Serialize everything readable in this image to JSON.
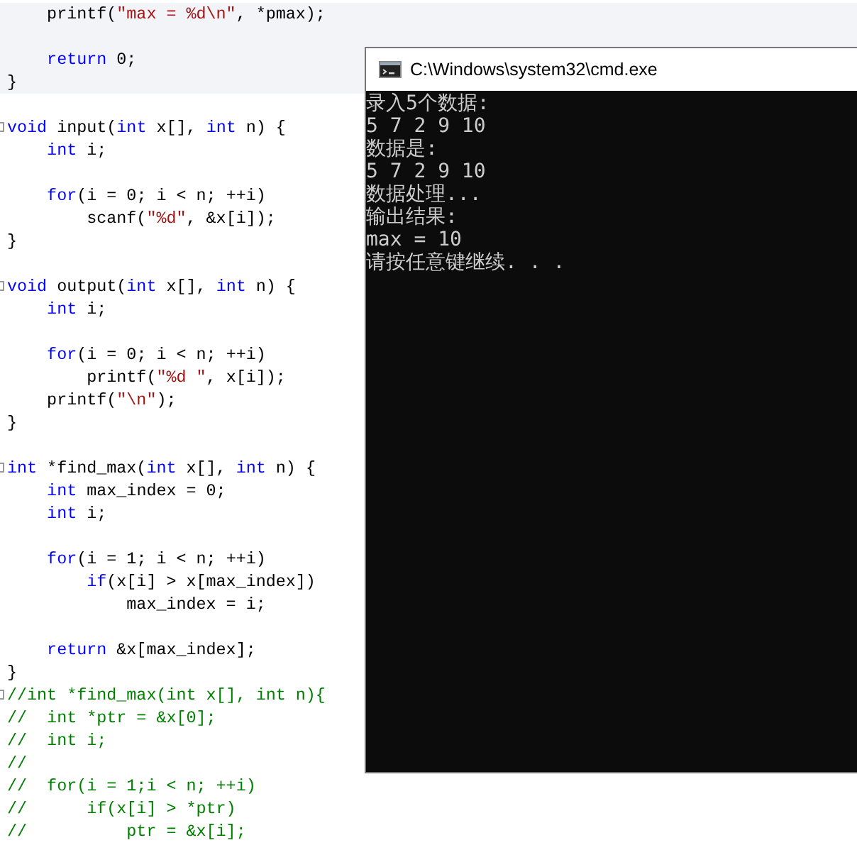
{
  "editor": {
    "blocks": [
      {
        "highlighted": true,
        "lines": [
          {
            "kind": "code",
            "fold": false,
            "tokens": [
              {
                "kind": "plain",
                "text": "    printf("
              },
              {
                "kind": "string",
                "text": "\"max = %d\\n\""
              },
              {
                "kind": "plain",
                "text": ", *pmax);"
              }
            ]
          },
          {
            "kind": "blank"
          },
          {
            "kind": "code",
            "fold": false,
            "tokens": [
              {
                "kind": "keyword",
                "text": "    return"
              },
              {
                "kind": "plain",
                "text": " 0;"
              }
            ]
          },
          {
            "kind": "code",
            "fold": false,
            "tokens": [
              {
                "kind": "plain",
                "text": "}"
              }
            ]
          }
        ]
      },
      {
        "highlighted": false,
        "lines": [
          {
            "kind": "blank"
          },
          {
            "kind": "code",
            "fold": true,
            "tokens": [
              {
                "kind": "keyword",
                "text": "void"
              },
              {
                "kind": "plain",
                "text": " input("
              },
              {
                "kind": "keyword",
                "text": "int"
              },
              {
                "kind": "plain",
                "text": " x[], "
              },
              {
                "kind": "keyword",
                "text": "int"
              },
              {
                "kind": "plain",
                "text": " n) {"
              }
            ]
          },
          {
            "kind": "code",
            "fold": false,
            "tokens": [
              {
                "kind": "keyword",
                "text": "    int"
              },
              {
                "kind": "plain",
                "text": " i;"
              }
            ]
          },
          {
            "kind": "blank"
          },
          {
            "kind": "code",
            "fold": false,
            "tokens": [
              {
                "kind": "keyword",
                "text": "    for"
              },
              {
                "kind": "plain",
                "text": "(i = 0; i < n; ++i)"
              }
            ]
          },
          {
            "kind": "code",
            "fold": false,
            "tokens": [
              {
                "kind": "plain",
                "text": "        scanf("
              },
              {
                "kind": "string",
                "text": "\"%d\""
              },
              {
                "kind": "plain",
                "text": ", &x[i]);"
              }
            ]
          },
          {
            "kind": "code",
            "fold": false,
            "tokens": [
              {
                "kind": "plain",
                "text": "}"
              }
            ]
          },
          {
            "kind": "blank"
          },
          {
            "kind": "code",
            "fold": true,
            "tokens": [
              {
                "kind": "keyword",
                "text": "void"
              },
              {
                "kind": "plain",
                "text": " output("
              },
              {
                "kind": "keyword",
                "text": "int"
              },
              {
                "kind": "plain",
                "text": " x[], "
              },
              {
                "kind": "keyword",
                "text": "int"
              },
              {
                "kind": "plain",
                "text": " n) {"
              }
            ]
          },
          {
            "kind": "code",
            "fold": false,
            "tokens": [
              {
                "kind": "keyword",
                "text": "    int"
              },
              {
                "kind": "plain",
                "text": " i;"
              }
            ]
          },
          {
            "kind": "blank"
          },
          {
            "kind": "code",
            "fold": false,
            "tokens": [
              {
                "kind": "keyword",
                "text": "    for"
              },
              {
                "kind": "plain",
                "text": "(i = 0; i < n; ++i)"
              }
            ]
          },
          {
            "kind": "code",
            "fold": false,
            "tokens": [
              {
                "kind": "plain",
                "text": "        printf("
              },
              {
                "kind": "string",
                "text": "\"%d \""
              },
              {
                "kind": "plain",
                "text": ", x[i]);"
              }
            ]
          },
          {
            "kind": "code",
            "fold": false,
            "tokens": [
              {
                "kind": "plain",
                "text": "    printf("
              },
              {
                "kind": "string",
                "text": "\"\\n\""
              },
              {
                "kind": "plain",
                "text": ");"
              }
            ]
          },
          {
            "kind": "code",
            "fold": false,
            "tokens": [
              {
                "kind": "plain",
                "text": "}"
              }
            ]
          },
          {
            "kind": "blank"
          },
          {
            "kind": "code",
            "fold": true,
            "tokens": [
              {
                "kind": "keyword",
                "text": "int"
              },
              {
                "kind": "plain",
                "text": " *find_max("
              },
              {
                "kind": "keyword",
                "text": "int"
              },
              {
                "kind": "plain",
                "text": " x[], "
              },
              {
                "kind": "keyword",
                "text": "int"
              },
              {
                "kind": "plain",
                "text": " n) {"
              }
            ]
          },
          {
            "kind": "code",
            "fold": false,
            "tokens": [
              {
                "kind": "keyword",
                "text": "    int"
              },
              {
                "kind": "plain",
                "text": " max_index = 0;"
              }
            ]
          },
          {
            "kind": "code",
            "fold": false,
            "tokens": [
              {
                "kind": "keyword",
                "text": "    int"
              },
              {
                "kind": "plain",
                "text": " i;"
              }
            ]
          },
          {
            "kind": "blank"
          },
          {
            "kind": "code",
            "fold": false,
            "tokens": [
              {
                "kind": "keyword",
                "text": "    for"
              },
              {
                "kind": "plain",
                "text": "(i = 1; i < n; ++i)"
              }
            ]
          },
          {
            "kind": "code",
            "fold": false,
            "tokens": [
              {
                "kind": "keyword",
                "text": "        if"
              },
              {
                "kind": "plain",
                "text": "(x[i] > x[max_index])"
              }
            ]
          },
          {
            "kind": "code",
            "fold": false,
            "tokens": [
              {
                "kind": "plain",
                "text": "            max_index = i;"
              }
            ]
          },
          {
            "kind": "blank"
          },
          {
            "kind": "code",
            "fold": false,
            "tokens": [
              {
                "kind": "keyword",
                "text": "    return"
              },
              {
                "kind": "plain",
                "text": " &x[max_index];"
              }
            ]
          },
          {
            "kind": "code",
            "fold": false,
            "tokens": [
              {
                "kind": "plain",
                "text": "}"
              }
            ]
          },
          {
            "kind": "code",
            "fold": true,
            "tokens": [
              {
                "kind": "comment",
                "text": "//int *find_max(int x[], int n){"
              }
            ]
          },
          {
            "kind": "code",
            "fold": false,
            "tokens": [
              {
                "kind": "comment",
                "text": "//  int *ptr = &x[0];"
              }
            ]
          },
          {
            "kind": "code",
            "fold": false,
            "tokens": [
              {
                "kind": "comment",
                "text": "//  int i;"
              }
            ]
          },
          {
            "kind": "code",
            "fold": false,
            "tokens": [
              {
                "kind": "comment",
                "text": "//"
              }
            ]
          },
          {
            "kind": "code",
            "fold": false,
            "tokens": [
              {
                "kind": "comment",
                "text": "//  for(i = 1;i < n; ++i)"
              }
            ]
          },
          {
            "kind": "code",
            "fold": false,
            "tokens": [
              {
                "kind": "comment",
                "text": "//      if(x[i] > *ptr)"
              }
            ]
          },
          {
            "kind": "code",
            "fold": false,
            "tokens": [
              {
                "kind": "comment",
                "text": "//          ptr = &x[i];"
              }
            ]
          }
        ]
      }
    ]
  },
  "console": {
    "title": "C:\\Windows\\system32\\cmd.exe",
    "lines": [
      "录入5个数据:",
      "5 7 2 9 10",
      "数据是:",
      "5 7 2 9 10",
      "数据处理...",
      "输出结果:",
      "max = 10",
      "请按任意键继续. . ."
    ]
  }
}
